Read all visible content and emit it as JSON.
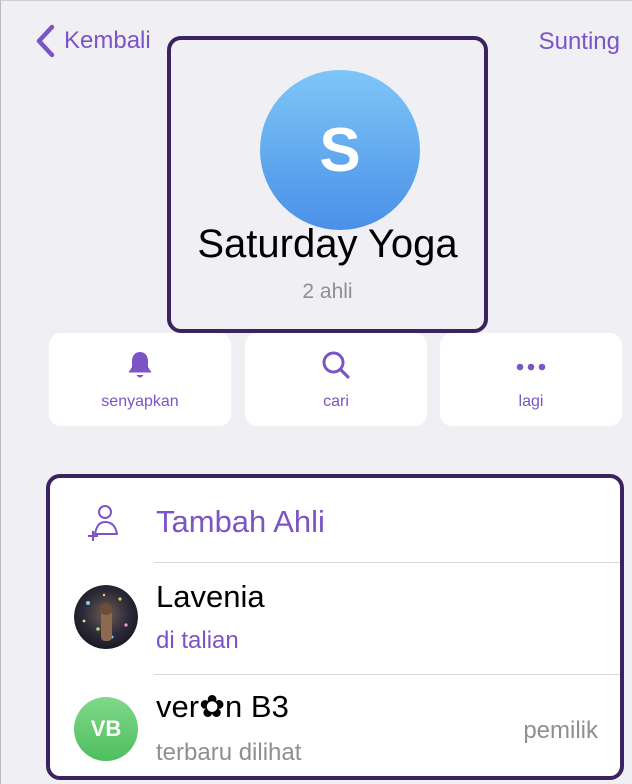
{
  "nav": {
    "back_label": "Kembali",
    "edit_label": "Sunting"
  },
  "group": {
    "avatar_letter": "S",
    "title": "Saturday Yoga",
    "subtitle": "2 ahli"
  },
  "actions": [
    {
      "label": "senyapkan",
      "icon": "bell-icon"
    },
    {
      "label": "cari",
      "icon": "search-icon"
    },
    {
      "label": "lagi",
      "icon": "more-icon"
    }
  ],
  "members": {
    "add_label": "Tambah Ahli",
    "list": [
      {
        "name": "Lavenia",
        "status": "di talian",
        "role": ""
      },
      {
        "name": "ver✿n B3",
        "status": "terbaru dilihat",
        "role": "pemilik",
        "initials": "VB"
      }
    ]
  },
  "colors": {
    "accent": "#7b54c6",
    "frame": "#3b2360",
    "background": "#efeff4",
    "avatar_green": "#5cc86a"
  }
}
